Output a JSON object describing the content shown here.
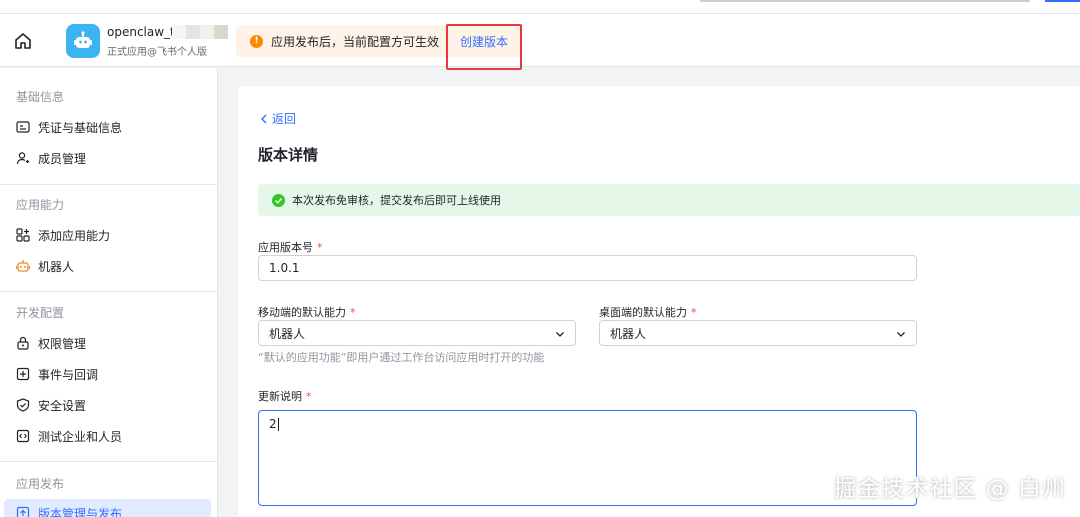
{
  "header": {
    "app_name": "openclaw_te",
    "app_subtitle": "正式应用@飞书个人版",
    "notice_text": "应用发布后，当前配置方可生效",
    "create_version_link": "创建版本"
  },
  "sidebar": {
    "sections": [
      {
        "title": "基础信息",
        "items": [
          {
            "label": "凭证与基础信息",
            "icon": "id-card-icon"
          },
          {
            "label": "成员管理",
            "icon": "user-add-icon"
          }
        ]
      },
      {
        "title": "应用能力",
        "items": [
          {
            "label": "添加应用能力",
            "icon": "apps-add-icon"
          },
          {
            "label": "机器人",
            "icon": "robot-icon"
          }
        ]
      },
      {
        "title": "开发配置",
        "items": [
          {
            "label": "权限管理",
            "icon": "lock-icon"
          },
          {
            "label": "事件与回调",
            "icon": "event-icon"
          },
          {
            "label": "安全设置",
            "icon": "shield-icon"
          },
          {
            "label": "测试企业和人员",
            "icon": "code-icon"
          }
        ]
      },
      {
        "title": "应用发布",
        "items": [
          {
            "label": "版本管理与发布",
            "icon": "publish-icon",
            "active": true
          }
        ]
      }
    ]
  },
  "main": {
    "back_label": "返回",
    "page_title": "版本详情",
    "success_notice": "本次发布免审核，提交发布后即可上线使用",
    "version_label": "应用版本号",
    "version_value": "1.0.1",
    "mobile_default_label": "移动端的默认能力",
    "mobile_default_value": "机器人",
    "desktop_default_label": "桌面端的默认能力",
    "desktop_default_value": "机器人",
    "default_hint": "“默认的应用功能”即用户通过工作台访问应用时打开的功能",
    "changelog_label": "更新说明",
    "changelog_value": "2",
    "required_mark": "*"
  },
  "watermark": "掘金技术社区 @ 白州",
  "colors": {
    "accent": "#3370ff",
    "warning": "#ff8800",
    "success": "#34c724",
    "highlight_box": "#e8383d",
    "required": "#f54a45"
  }
}
